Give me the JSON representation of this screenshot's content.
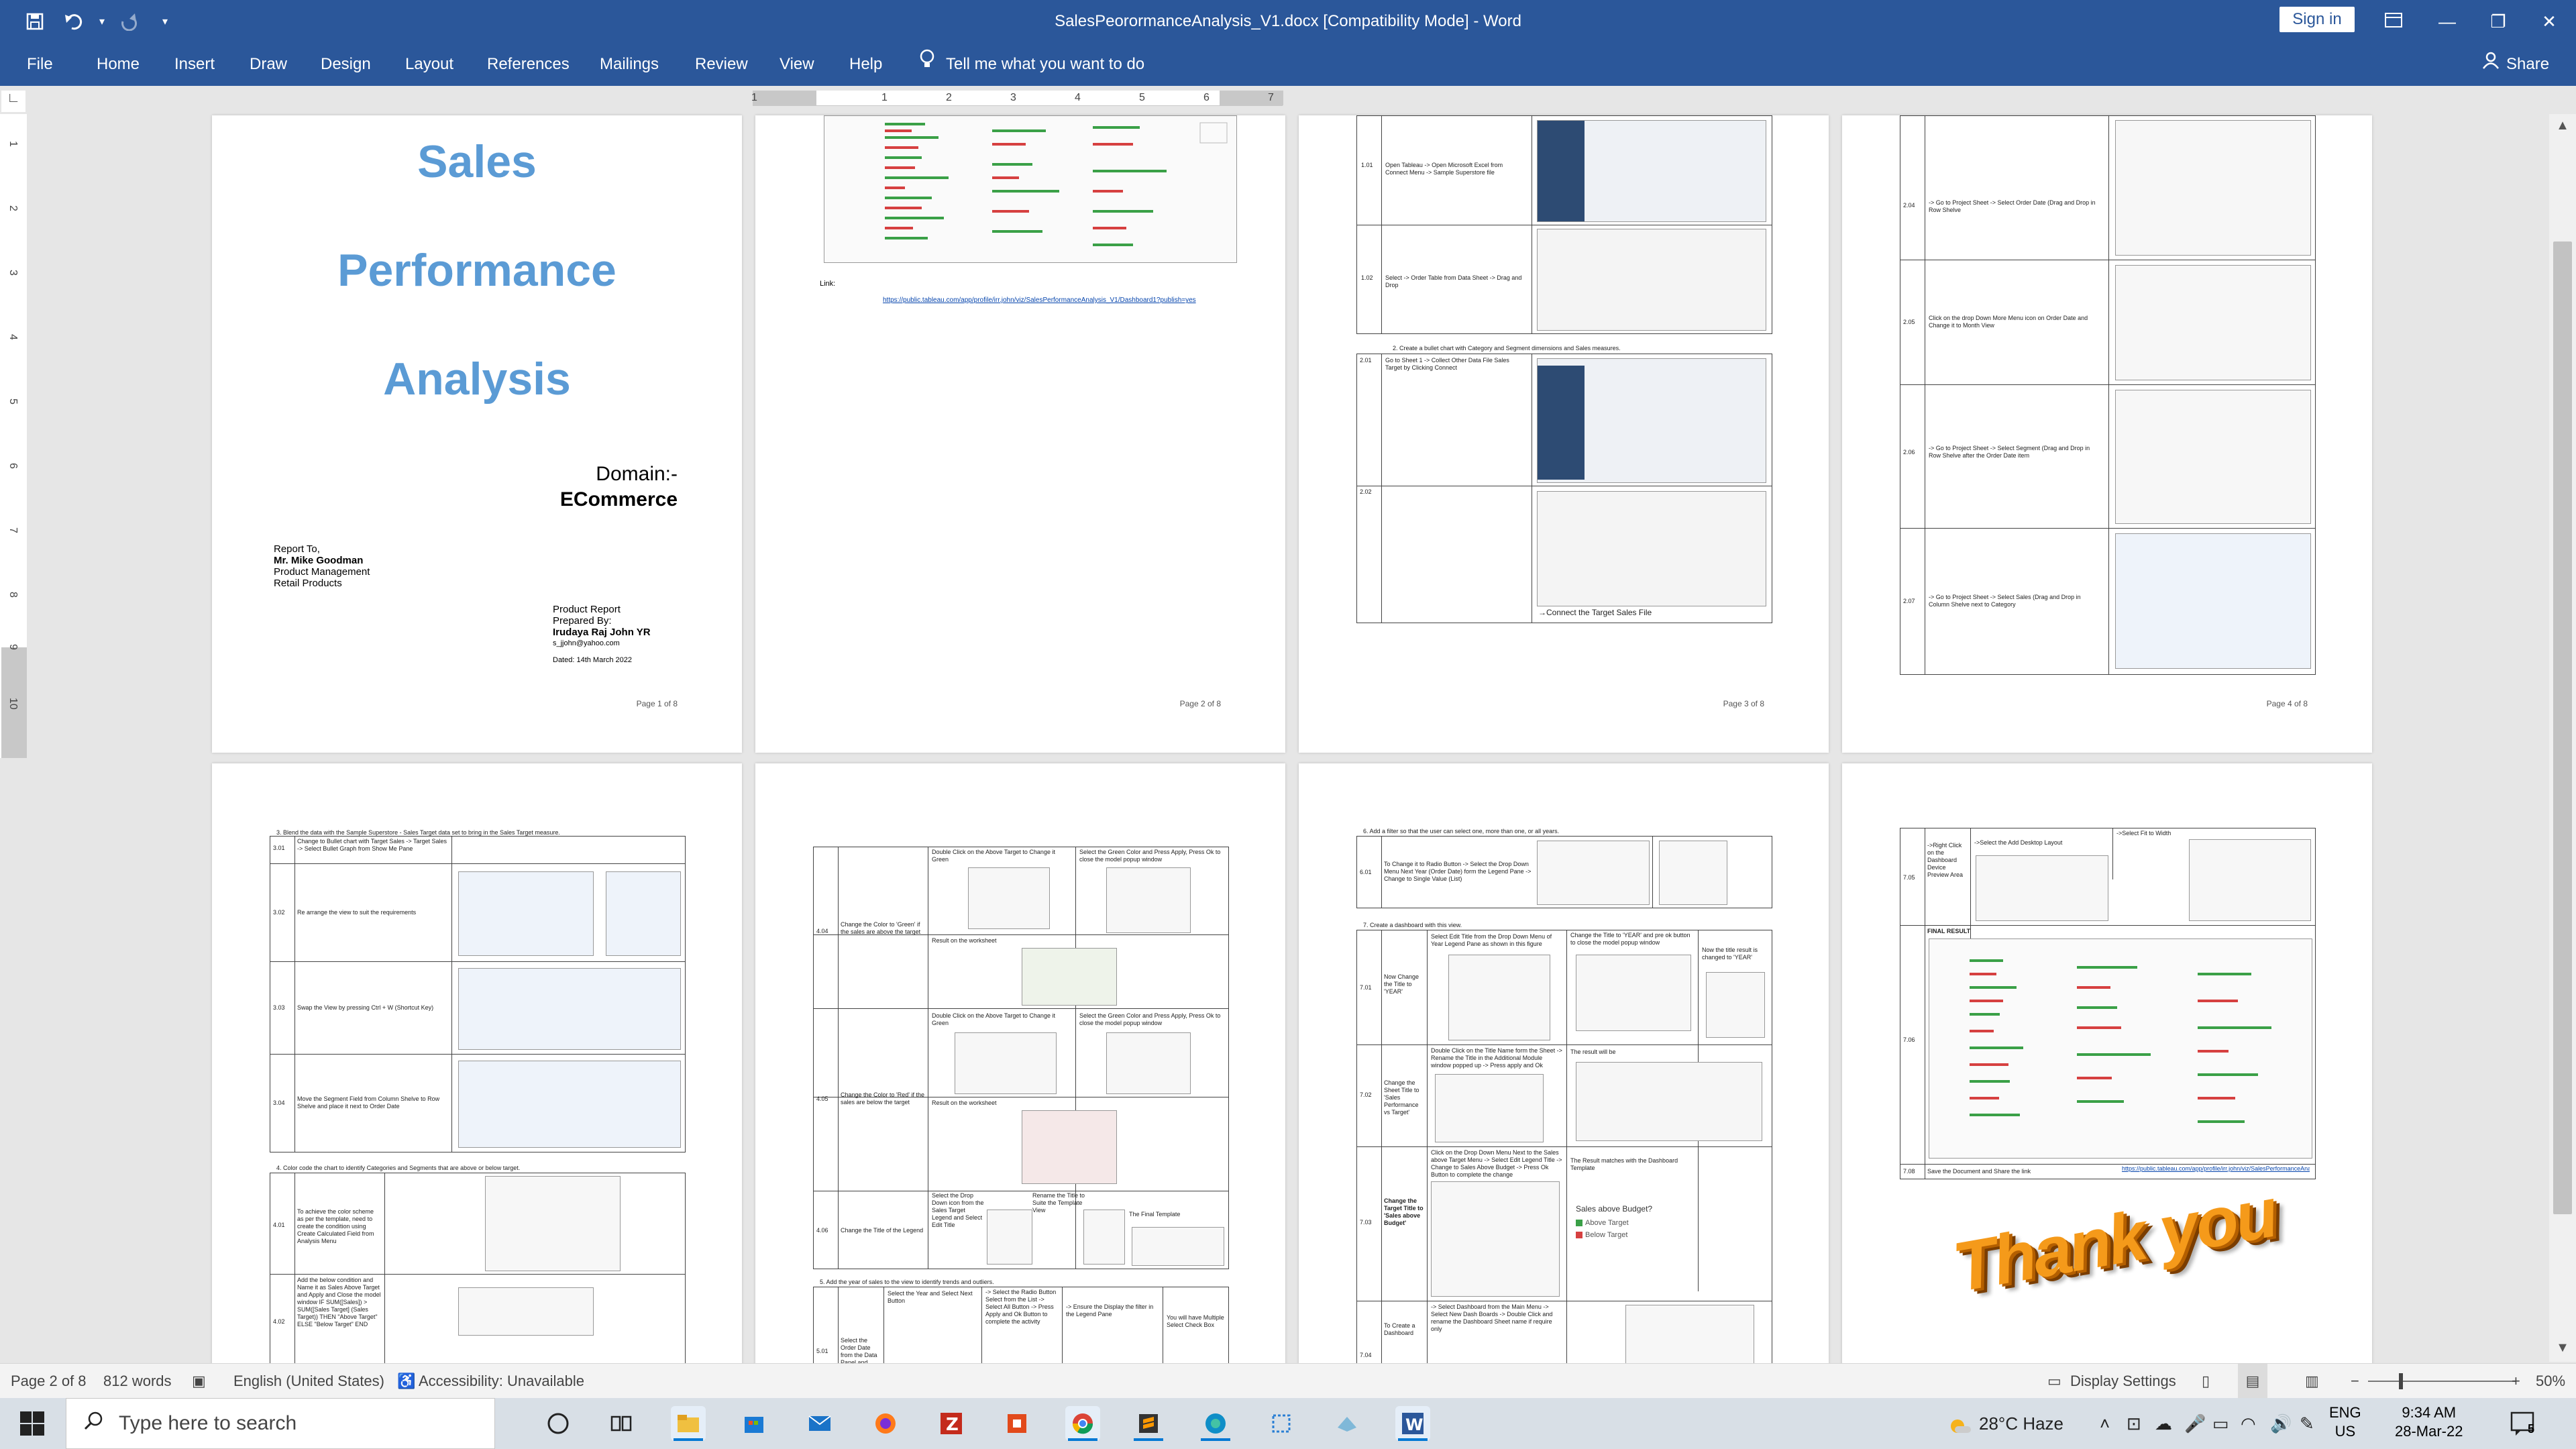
{
  "window": {
    "title": "SalesPeorormanceAnalysis_V1.docx [Compatibility Mode]  -  Word",
    "sign_in": "Sign in",
    "quick_access": [
      "save-icon",
      "undo-icon",
      "redo-icon",
      "customize-icon"
    ]
  },
  "ribbon": {
    "tabs": [
      "File",
      "Home",
      "Insert",
      "Draw",
      "Design",
      "Layout",
      "References",
      "Mailings",
      "Review",
      "View",
      "Help"
    ],
    "tell_me": "Tell me what you want to do",
    "share": "Share"
  },
  "ruler": {
    "h_ticks": [
      "1",
      "1",
      "2",
      "3",
      "4",
      "5",
      "6",
      "7"
    ],
    "v_ticks": [
      "1",
      "2",
      "3",
      "4",
      "5",
      "6",
      "7",
      "8",
      "9",
      "10"
    ]
  },
  "pages": [
    {
      "page_label": "Page 1 of 8",
      "title_lines": [
        "Sales",
        "Performance",
        "Analysis"
      ],
      "domain_label": "Domain:-",
      "domain_value": "ECommerce",
      "report_to": [
        "Report To,",
        "Mr. Mike Goodman",
        "Product Management",
        "Retail Products"
      ],
      "prepared": [
        "Product Report",
        "Prepared By:",
        "Irudaya Raj John YR",
        "s_jjohn@yahoo.com",
        "Dated: 14th March 2022"
      ]
    },
    {
      "page_label": "Page 2 of 8",
      "link_label": "Link:",
      "link_url": "https://public.tableau.com/app/profile/irr.john/viz/SalesPerformanceAnalysis_V1/Dashboard1?publish=yes"
    },
    {
      "page_label": "Page 3 of 8",
      "rows": [
        {
          "id": "1.01",
          "text": "Open Tableau -> Open Microsoft Excel from Connect Menu -> Sample Superstore file"
        },
        {
          "id": "1.02",
          "text": "Select -> Order Table from Data Sheet -> Drag and Drop"
        },
        {
          "id": "2.01",
          "text": "Go to Sheet 1 -> Collect Other Data File Sales Target by Clicking Connect"
        },
        {
          "id": "2.02",
          "text": ""
        }
      ],
      "section": "2. Create a bullet chart with Category and Segment dimensions and Sales measures.",
      "caption": "→Connect the Target Sales File"
    },
    {
      "page_label": "Page 4 of 8",
      "rows": [
        {
          "id": "2.04",
          "text": "-> Go to Project Sheet -> Select Order Date (Drag and Drop in Row Shelve"
        },
        {
          "id": "2.05",
          "text": "Click on the drop Down More Menu icon on Order Date and Change it to Month View"
        },
        {
          "id": "2.06",
          "text": "-> Go to Project Sheet -> Select Segment (Drag and Drop in Row Shelve after the Order Date item"
        },
        {
          "id": "2.07",
          "text": "-> Go to Project Sheet -> Select Sales (Drag and Drop in Column Shelve next to Category"
        }
      ]
    },
    {
      "page_label": "",
      "section": "3. Blend the data with the Sample Superstore - Sales Target data set to bring in the Sales Target measure.",
      "rows": [
        {
          "id": "3.01",
          "text": "Change to Bullet chart with Target Sales -> Target Sales -> Select Bullet Graph from Show Me Pane"
        },
        {
          "id": "3.02",
          "text": "Re arrange the view to suit the requirements"
        },
        {
          "id": "3.03",
          "text": "Swap the View by pressing Ctrl + W (Shortcut Key)"
        },
        {
          "id": "3.04",
          "text": "Move the Segment Field from Column Shelve to Row Shelve and place it next to Order Date"
        }
      ],
      "section2": "4. Color code the chart to identify Categories and Segments that are above or below target.",
      "rows2": [
        {
          "id": "4.01",
          "text": "To achieve the color scheme as per the template, need to create the condition using Create Calculated Field from Analysis Menu"
        },
        {
          "id": "4.02",
          "text": "Add the below condition and Name it as Sales Above Target and Apply and Close the model window  IF SUM([Sales]) > SUM([Sales Target] (Sales Target)) THEN \"Above Target\" ELSE \"Below Target\" END"
        }
      ]
    },
    {
      "page_label": "",
      "rows": [
        {
          "id": "4.04",
          "text": "Change the Color to 'Green' if the sales are above the target",
          "col2": "Double Click on the Above Target to Change it Green",
          "col3": "Select the Green Color and Press Apply, Press Ok to close the model popup window"
        },
        {
          "id": "4.05",
          "text": "Change the Color to 'Red' if the sales are below the target",
          "col2": "Double Click on the Above Target to Change it Green",
          "col3": "Select the Green Color and Press Apply, Press Ok to close the model popup window"
        },
        {
          "id": "4.06",
          "text": "Change the Title of the Legend",
          "col2": "Select the Drop Down icon from the Sales Target Legend and Select Edit Title",
          "col3": "Rename the Title to Suite the Template View",
          "col4": "The Final Template"
        }
      ],
      "result_label": "Result on the worksheet",
      "section": "5. Add the year of sales to the view to identify trends and outliers.",
      "row5": {
        "id": "5.01",
        "text": "Select the Order Date from the Data Panel and drop in Filter",
        "col2": "Select the Year and Select Next Button",
        "col3": "-> Select the Radio Button Select from the List -> Select All Button -> Press Apply and Ok Button to complete the activity",
        "col4": "-> Ensure the Display the filter in the Legend Pane",
        "col5": "You will have Multiple Select Check Box"
      }
    },
    {
      "page_label": "",
      "section": "6. Add a filter so that the user can select one, more than one, or all years.",
      "row6": {
        "id": "6.01",
        "text": "To Change it to Radio Button -> Select the Drop Down Menu Next Year (Order Date) form the Legend Pane -> Change to Single Value (List)"
      },
      "section2": "7. Create a dashboard with this view.",
      "rows": [
        {
          "id": "7.01",
          "text": "Now Change the Title to 'YEAR'",
          "col2": "Select Edit Title from the Drop Down Menu of Year Legend Pane as shown in this figure",
          "col3": "Change the Title to 'YEAR' and pre ok button to close the model popup window",
          "col4": "Now the title result is changed to 'YEAR'"
        },
        {
          "id": "7.02",
          "text": "Change the Sheet Title to 'Sales Performance vs Target'",
          "col2": "Double Click on the Title Name form the Sheet -> Rename the Title in the Additional Module window popped up -> Press apply and Ok",
          "col3": "The result will be"
        },
        {
          "id": "7.03",
          "text": "Change the Target Title to 'Sales above Budget'",
          "col2": "Click on the Drop Down Menu Next to the Sales above Target Menu -> Select Edit Legend Title -> Change to Sales Above Budget -> Press Ok Button to complete the change",
          "col3": "The Result matches with the Dashboard Template",
          "legend_title": "Sales above Budget?",
          "legend_items": [
            "Above Target",
            "Below Target"
          ]
        },
        {
          "id": "7.04",
          "text": "To Create a Dashboard",
          "col2": "-> Select Dashboard from the Main Menu -> Select New Dash Boards -> Double Click and rename the Dashboard Sheet name if require only"
        }
      ]
    },
    {
      "page_label": "",
      "rows": [
        {
          "id": "7.05",
          "text": "->Right Click on the Dashboard Device Preview Area",
          "col2": "->Select the Add Desktop Layout",
          "col3": "->Select Fit to Width"
        },
        {
          "id": "7.06",
          "text": "FINAL RESULT"
        },
        {
          "id": "7.08",
          "text": "Save the Document and Share the link",
          "col2": "https://public.tableau.com/app/profile/irr.john/viz/SalesPerformanceAnalysis_V1/Dashboard1?publish=yes"
        }
      ],
      "thanks": "Thank you"
    }
  ],
  "status": {
    "page": "Page 2 of 8",
    "words": "812 words",
    "language": "English (United States)",
    "accessibility": "Accessibility: Unavailable",
    "display_settings": "Display Settings",
    "zoom": "50%",
    "zoom_level": 0.5
  },
  "taskbar": {
    "search_placeholder": "Type here to search",
    "apps": [
      "cortana-icon",
      "task-view-icon",
      "file-explorer-icon",
      "store-icon",
      "mail-icon",
      "firefox-icon",
      "filezilla-icon",
      "office-icon",
      "chrome-icon",
      "sublime-icon",
      "edge-icon",
      "snipping-icon",
      "folder-icon",
      "word-icon"
    ],
    "weather": "28°C  Haze",
    "lang1": "ENG",
    "lang2": "US",
    "time": "9:34 AM",
    "date": "28-Mar-22",
    "notifications": "5"
  },
  "colors": {
    "accent": "#2b579a",
    "title_blue": "#5b9bd5",
    "thanks_orange": "#f59a1a",
    "green": "#3aa047",
    "red": "#d64040"
  }
}
